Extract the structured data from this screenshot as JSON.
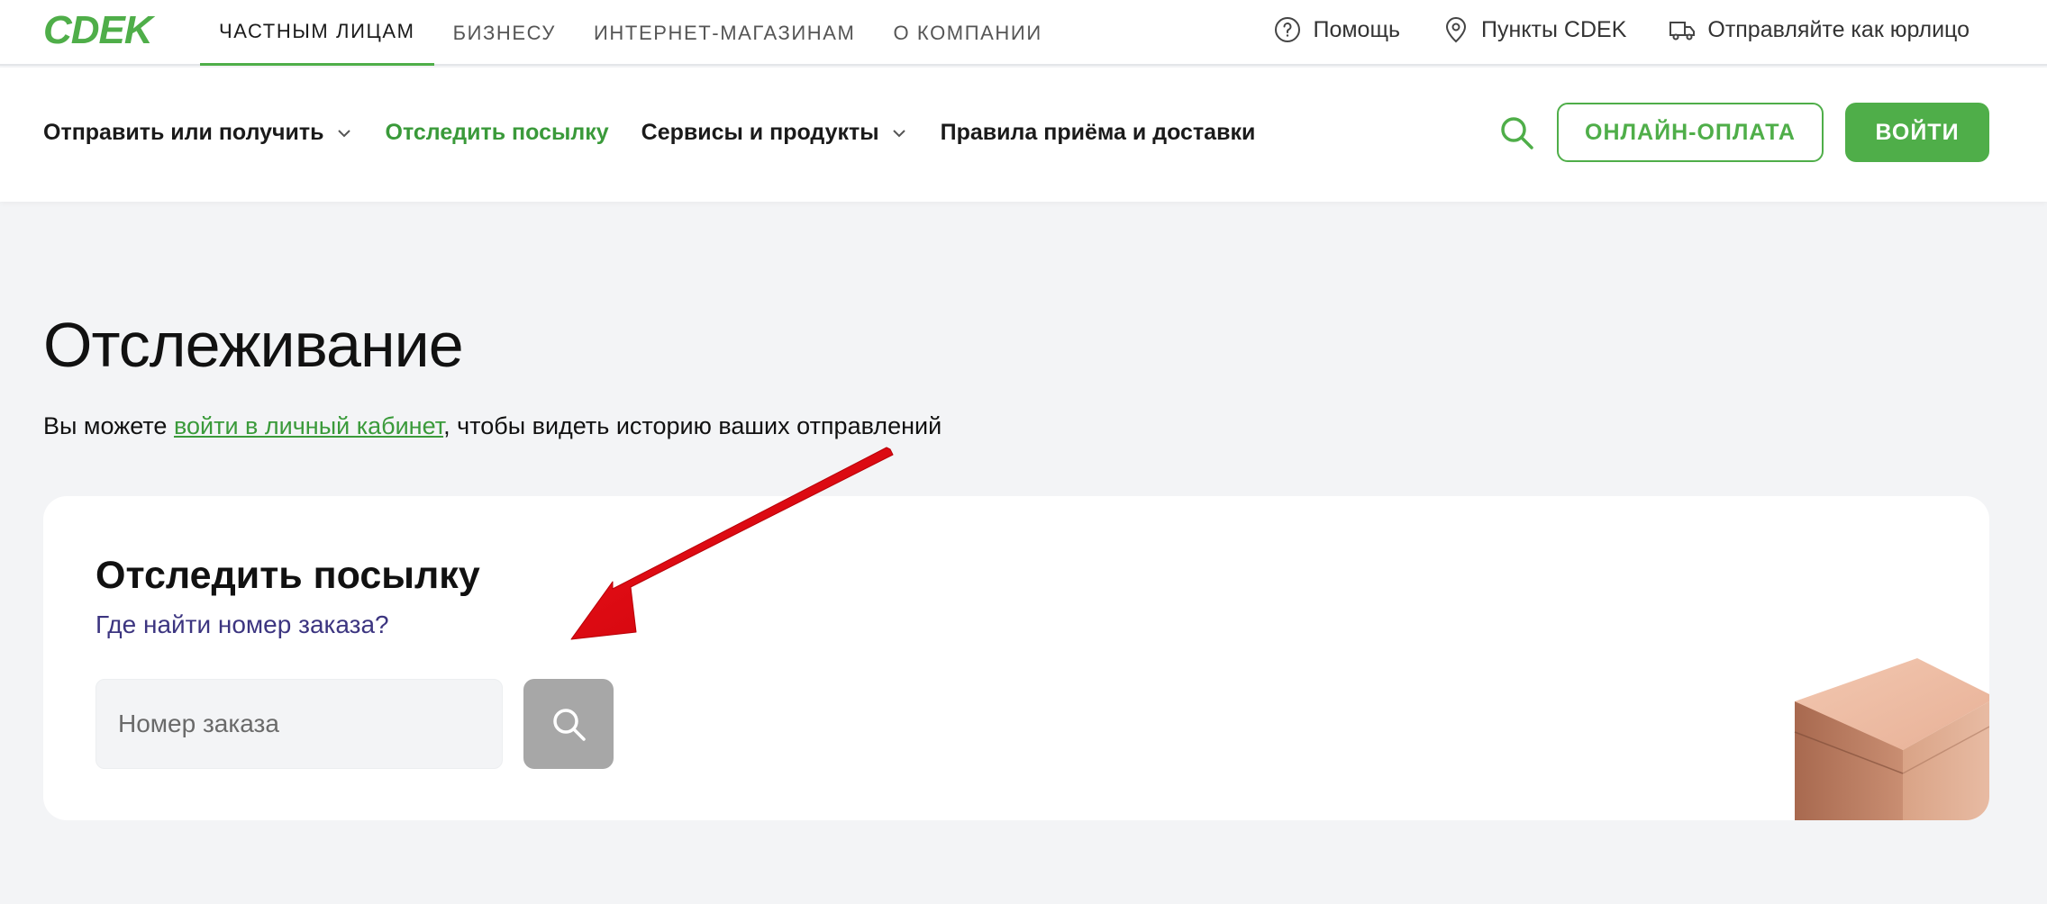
{
  "brand": {
    "logo_text": "CDEK",
    "accent": "#4fae49",
    "link_color": "#3c3580",
    "annotation_color": "#e3000b"
  },
  "topnav": {
    "items": [
      {
        "label": "ЧАСТНЫМ ЛИЦАМ",
        "active": true
      },
      {
        "label": "БИЗНЕСУ"
      },
      {
        "label": "ИНТЕРНЕТ-МАГАЗИНАМ"
      },
      {
        "label": "О КОМПАНИИ"
      }
    ],
    "links": [
      {
        "label": "Помощь",
        "icon": "help-circle-icon"
      },
      {
        "label": "Пункты CDEK",
        "icon": "location-pin-icon"
      },
      {
        "label": "Отправляйте как юрлицо",
        "icon": "truck-icon"
      }
    ]
  },
  "mainnav": {
    "items": [
      {
        "label": "Отправить или получить",
        "dropdown": true
      },
      {
        "label": "Отследить посылку",
        "active": true
      },
      {
        "label": "Сервисы и продукты",
        "dropdown": true
      },
      {
        "label": "Правила приёма и доставки"
      }
    ],
    "search_icon": "search-icon",
    "pay_button": "ОНЛАЙН-ОПЛАТА",
    "login_button": "ВОЙТИ"
  },
  "page": {
    "title": "Отслеживание",
    "subtitle_before": "Вы можете ",
    "subtitle_link": "войти в личный кабинет",
    "subtitle_after": ", чтобы видеть историю ваших отправлений"
  },
  "tracking_card": {
    "title": "Отследить посылку",
    "help_link": "Где найти номер заказа?",
    "input_value": "",
    "input_placeholder": "Номер заказа",
    "search_button_icon": "search-icon",
    "illustration": "parcel-box-illustration"
  }
}
